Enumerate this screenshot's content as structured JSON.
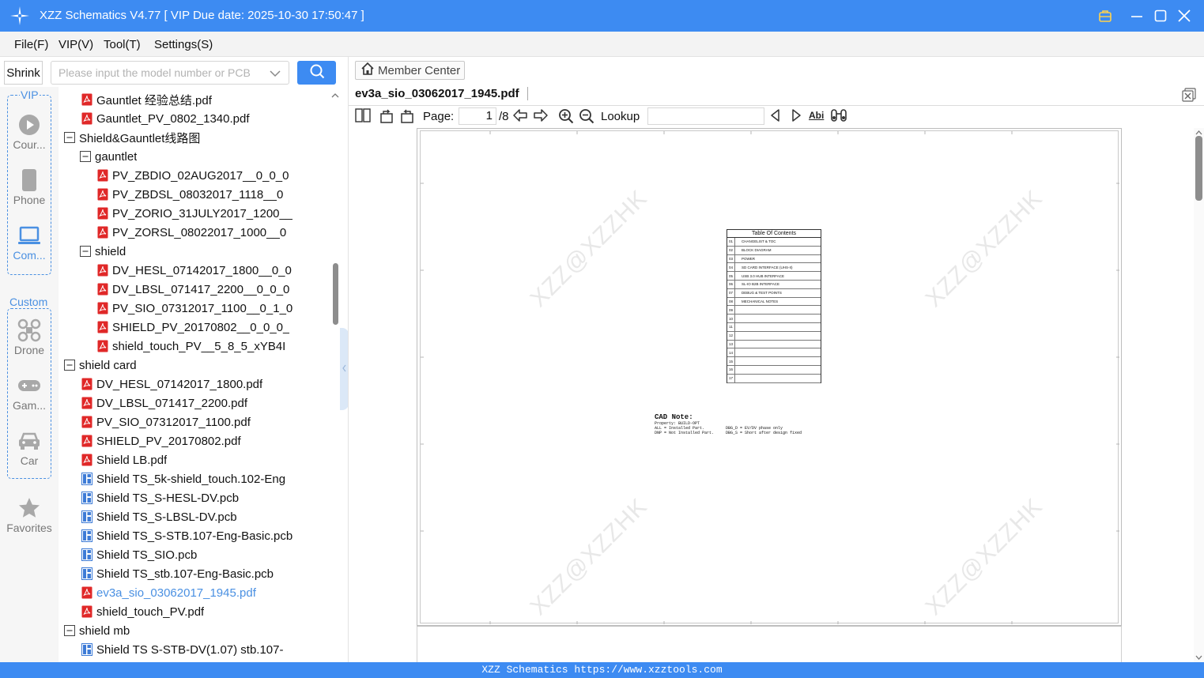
{
  "window": {
    "title": "XZZ Schematics V4.77 [ VIP Due date: 2025-10-30 17:50:47 ]",
    "accent": "#3d8bf2"
  },
  "menu": [
    "File(F)",
    "VIP(V)",
    "Tool(T)",
    "Settings(S)"
  ],
  "left_search": {
    "shrink_label": "Shrink",
    "placeholder": "Please input the model number or PCB"
  },
  "rail": {
    "vip_label": "VIP",
    "custom_label": "Custom",
    "items": [
      {
        "label": "Cour...",
        "icon": "play-icon"
      },
      {
        "label": "Phone",
        "icon": "phone-icon"
      },
      {
        "label": "Com...",
        "icon": "laptop-icon"
      },
      {
        "label": "Drone",
        "icon": "drone-icon"
      },
      {
        "label": "Gam...",
        "icon": "gamepad-icon"
      },
      {
        "label": "Car",
        "icon": "car-icon"
      },
      {
        "label": "Favorites",
        "icon": "star-icon"
      }
    ]
  },
  "tree": [
    {
      "label": "Gauntlet 经验总结.pdf",
      "type": "pdf",
      "level": 1
    },
    {
      "label": "Gauntlet_PV_0802_1340.pdf",
      "type": "pdf",
      "level": 1
    },
    {
      "label": "Shield&Gauntlet线路图",
      "type": "folder",
      "level": 0
    },
    {
      "label": "gauntlet",
      "type": "folder",
      "level": 1
    },
    {
      "label": "PV_ZBDIO_02AUG2017__0_0_0",
      "type": "pdf",
      "level": 2
    },
    {
      "label": "PV_ZBDSL_08032017_1118__0",
      "type": "pdf",
      "level": 2
    },
    {
      "label": "PV_ZORIO_31JULY2017_1200__",
      "type": "pdf",
      "level": 2
    },
    {
      "label": "PV_ZORSL_08022017_1000__0",
      "type": "pdf",
      "level": 2
    },
    {
      "label": "shield",
      "type": "folder",
      "level": 1
    },
    {
      "label": "DV_HESL_07142017_1800__0_0",
      "type": "pdf",
      "level": 2
    },
    {
      "label": "DV_LBSL_071417_2200__0_0_0",
      "type": "pdf",
      "level": 2
    },
    {
      "label": "PV_SIO_07312017_1100__0_1_0",
      "type": "pdf",
      "level": 2
    },
    {
      "label": "SHIELD_PV_20170802__0_0_0_",
      "type": "pdf",
      "level": 2
    },
    {
      "label": "shield_touch_PV__5_8_5_xYB4I",
      "type": "pdf",
      "level": 2
    },
    {
      "label": "shield card",
      "type": "folder",
      "level": 0
    },
    {
      "label": "DV_HESL_07142017_1800.pdf",
      "type": "pdf",
      "level": 1
    },
    {
      "label": "DV_LBSL_071417_2200.pdf",
      "type": "pdf",
      "level": 1
    },
    {
      "label": "PV_SIO_07312017_1100.pdf",
      "type": "pdf",
      "level": 1
    },
    {
      "label": "SHIELD_PV_20170802.pdf",
      "type": "pdf",
      "level": 1
    },
    {
      "label": "Shield LB.pdf",
      "type": "pdf",
      "level": 1
    },
    {
      "label": "Shield TS_5k-shield_touch.102-Eng",
      "type": "pcb",
      "level": 1
    },
    {
      "label": "Shield TS_S-HESL-DV.pcb",
      "type": "pcb",
      "level": 1
    },
    {
      "label": "Shield TS_S-LBSL-DV.pcb",
      "type": "pcb",
      "level": 1
    },
    {
      "label": "Shield TS_S-STB.107-Eng-Basic.pcb",
      "type": "pcb",
      "level": 1
    },
    {
      "label": "Shield TS_SIO.pcb",
      "type": "pcb",
      "level": 1
    },
    {
      "label": "Shield TS_stb.107-Eng-Basic.pcb",
      "type": "pcb",
      "level": 1
    },
    {
      "label": "ev3a_sio_03062017_1945.pdf",
      "type": "pdf",
      "level": 1,
      "selected": true
    },
    {
      "label": "shield_touch_PV.pdf",
      "type": "pdf",
      "level": 1
    },
    {
      "label": "shield mb",
      "type": "folder",
      "level": 0
    },
    {
      "label": "Shield TS S-STB-DV(1.07) stb.107-",
      "type": "pcb",
      "level": 1
    }
  ],
  "viewer": {
    "member_center": "Member Center",
    "doc_tab": "ev3a_sio_03062017_1945.pdf",
    "page_label": "Page:",
    "page_value": "1",
    "page_total": "/8",
    "lookup_label": "Lookup",
    "find_text_icon_label": "Abi"
  },
  "document": {
    "watermark": "XZZ@XZZHK",
    "toc_title": "Table Of Contents",
    "toc": [
      {
        "n": "01",
        "t": "CHANGELIST & TOC"
      },
      {
        "n": "02",
        "t": "BLOCK DIAGRAM"
      },
      {
        "n": "03",
        "t": "POWER"
      },
      {
        "n": "04",
        "t": "SD CARD INTERFACE (UHS-II)"
      },
      {
        "n": "05",
        "t": "USB 3.0 HUB INTERFACE"
      },
      {
        "n": "06",
        "t": "SL-IO B2B INTERFACE"
      },
      {
        "n": "07",
        "t": "DEBUG & TEST POINTS"
      },
      {
        "n": "08",
        "t": "MECHANICAL NOTES"
      },
      {
        "n": "09",
        "t": ""
      },
      {
        "n": "10",
        "t": ""
      },
      {
        "n": "11",
        "t": ""
      },
      {
        "n": "12",
        "t": ""
      },
      {
        "n": "13",
        "t": ""
      },
      {
        "n": "14",
        "t": ""
      },
      {
        "n": "15",
        "t": ""
      },
      {
        "n": "16",
        "t": ""
      },
      {
        "n": "17",
        "t": ""
      }
    ],
    "cad_title": "CAD Note:",
    "cad_lines": [
      "Property: BUILD-OPT",
      "ALL = Installed Part.         DBG_D = EV/DV phase only",
      "DNP = Not Installed Part.     DBG_S = Short after design fixed"
    ]
  },
  "statusbar": "XZZ Schematics https://www.xzztools.com"
}
